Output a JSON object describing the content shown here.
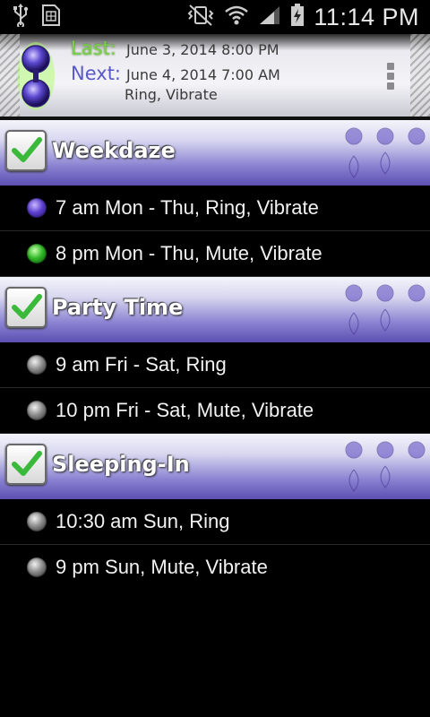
{
  "statusbar": {
    "time": "11:14 PM",
    "icons": [
      "usb-icon",
      "sim-icon",
      "vibrate-icon",
      "wifi-icon",
      "signal-icon",
      "battery-charging-icon"
    ]
  },
  "header": {
    "last_label": "Last:",
    "last_value": "June 3, 2014 8:00 PM",
    "next_label": "Next:",
    "next_value": "June 4, 2014 7:00 AM",
    "next_mode": "Ring, Vibrate",
    "colors": {
      "last": "#7bd14a",
      "next": "#5a59c9"
    }
  },
  "groups": [
    {
      "title": "Weekdaze",
      "checked": true,
      "items": [
        {
          "text": "7 am Mon - Thu, Ring, Vibrate",
          "dot": "purple"
        },
        {
          "text": "8 pm Mon - Thu, Mute, Vibrate",
          "dot": "green"
        }
      ]
    },
    {
      "title": "Party Time",
      "checked": true,
      "items": [
        {
          "text": "9 am Fri - Sat, Ring",
          "dot": "gray"
        },
        {
          "text": "10 pm Fri - Sat, Mute, Vibrate",
          "dot": "gray"
        }
      ]
    },
    {
      "title": "Sleeping-In",
      "checked": true,
      "items": [
        {
          "text": "10:30 am Sun, Ring",
          "dot": "gray"
        },
        {
          "text": "9 pm Sun, Mute, Vibrate",
          "dot": "gray"
        }
      ]
    }
  ]
}
